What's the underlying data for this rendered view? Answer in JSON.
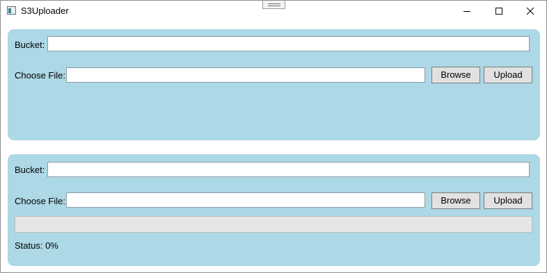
{
  "window": {
    "title": "S3Uploader",
    "icon": "app-window-icon",
    "controls": [
      "minimize-icon",
      "maximize-icon",
      "close-icon"
    ]
  },
  "colors": {
    "panel_background": "#add8e6",
    "button_background": "#e1e1e1",
    "progress_track": "#e6e6e6"
  },
  "panels": [
    {
      "bucket_label": "Bucket:",
      "bucket_value": "",
      "file_label": "Choose File:",
      "file_value": "",
      "browse_label": "Browse",
      "upload_label": "Upload"
    },
    {
      "bucket_label": "Bucket:",
      "bucket_value": "",
      "file_label": "Choose File:",
      "file_value": "",
      "browse_label": "Browse",
      "upload_label": "Upload",
      "progress_percent": 0,
      "status_text": "Status: 0%"
    }
  ]
}
